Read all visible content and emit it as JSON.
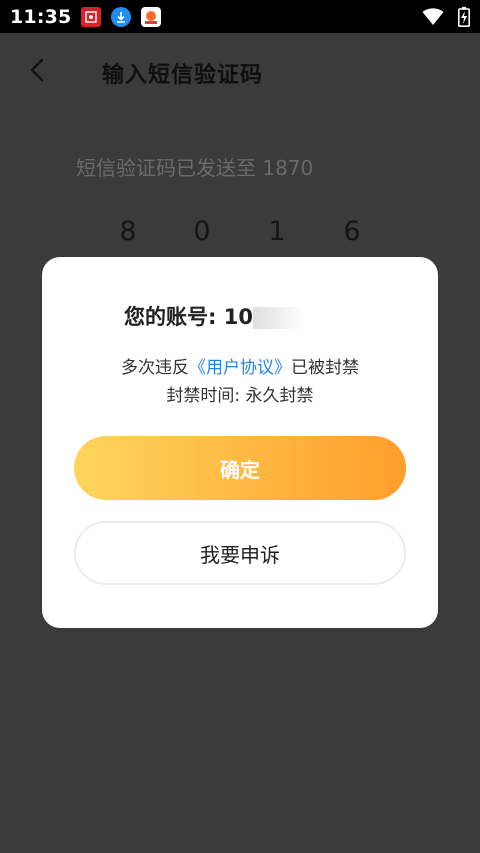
{
  "status_bar": {
    "time": "11:35",
    "notification_icons": [
      "red-app-icon",
      "download-icon",
      "app-icon"
    ],
    "wifi_icon": "wifi-icon",
    "battery_icon": "battery-charging-icon"
  },
  "page": {
    "title": "输入短信验证码",
    "sent_text": "短信验证码已发送至 1870",
    "code_digits": [
      "8",
      "0",
      "1",
      "6"
    ]
  },
  "dialog": {
    "account_label": "您的账号: ",
    "account_number_partial": "10",
    "violation_prefix": "多次违反",
    "violation_link": "《用户协议》",
    "violation_suffix": "已被封禁",
    "ban_time": "封禁时间: 永久封禁",
    "confirm_label": "确定",
    "appeal_label": "我要申诉"
  },
  "colors": {
    "accent_start": "#ffd55c",
    "accent_end": "#ff9e2c",
    "link": "#1f86e6",
    "overlay": "#3b3b3b"
  }
}
